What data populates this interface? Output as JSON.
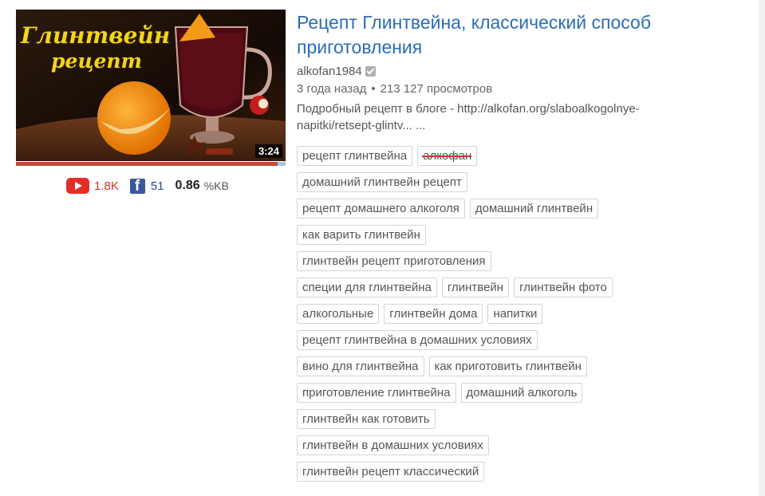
{
  "video": {
    "title": "Рецепт Глинтвейна, классический способ приготовления",
    "channel": "alkofan1984",
    "age": "3 года назад",
    "views": "213 127 просмотров",
    "description": "Подробный рецепт в блоге - http://alkofan.org/slaboalkogolnye-napitki/retsept-glintv... ...",
    "duration": "3:24",
    "thumbnail_text": [
      "Глинтвейн",
      "рецепт"
    ],
    "progress_fraction": 0.97
  },
  "stats": {
    "youtube_likes": "1.8K",
    "facebook_shares": "51",
    "kv_value": "0.86",
    "kv_unit": "%KB"
  },
  "tag_rows": [
    [
      {
        "label": "рецепт глинтвейна"
      },
      {
        "label": "алкофан",
        "struck": true
      }
    ],
    [
      {
        "label": "домашний глинтвейн рецепт"
      }
    ],
    [
      {
        "label": "рецепт домашнего алкоголя"
      },
      {
        "label": "домашний глинтвейн"
      }
    ],
    [
      {
        "label": "как варить глинтвейн"
      }
    ],
    [
      {
        "label": "глинтвейн рецепт приготовления"
      }
    ],
    [
      {
        "label": "специи для глинтвейна"
      },
      {
        "label": "глинтвейн"
      },
      {
        "label": "глинтвейн фото"
      }
    ],
    [
      {
        "label": "алкогольные"
      },
      {
        "label": "глинтвейн дома"
      },
      {
        "label": "напитки"
      }
    ],
    [
      {
        "label": "рецепт глинтвейна в домашних условиях"
      }
    ],
    [
      {
        "label": "вино для глинтвейна"
      },
      {
        "label": "как приготовить глинтвейн"
      }
    ],
    [
      {
        "label": "приготовление глинтвейна"
      },
      {
        "label": "домашний алкоголь"
      }
    ],
    [
      {
        "label": "глинтвейн как готовить"
      }
    ],
    [
      {
        "label": "глинтвейн в домашних условиях"
      }
    ],
    [
      {
        "label": "глинтвейн рецепт классический"
      }
    ]
  ],
  "colors": {
    "title_link": "#2a6db6",
    "youtube_red": "#e52d27",
    "facebook_blue": "#3b5998",
    "strike_red": "#d0342c"
  },
  "icons": [
    "youtube-icon",
    "facebook-icon",
    "verified-icon"
  ]
}
